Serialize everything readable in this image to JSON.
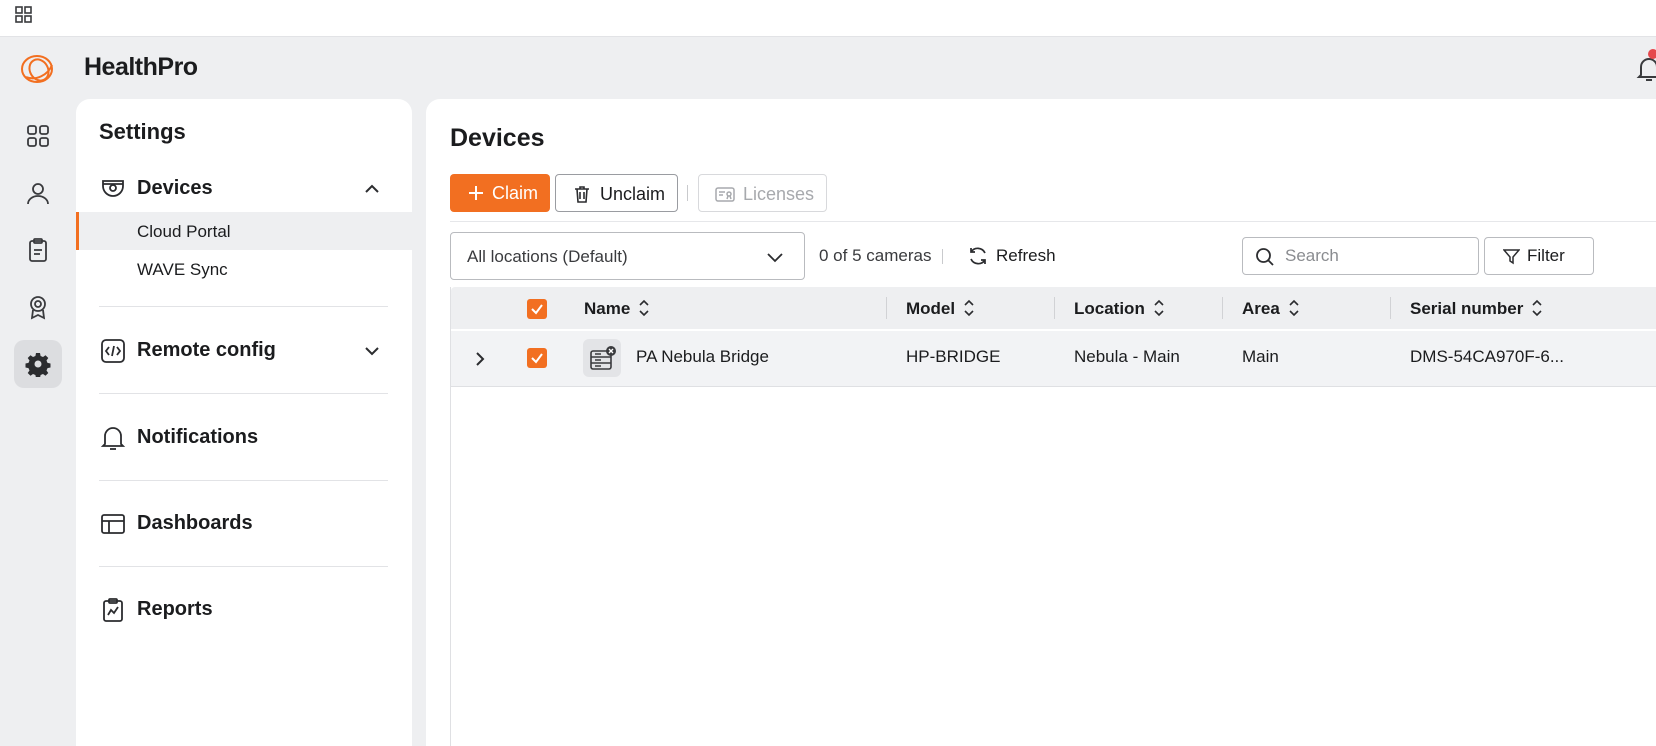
{
  "app": {
    "name": "HealthPro"
  },
  "settings": {
    "title": "Settings",
    "sections": {
      "devices": "Devices",
      "cloud_portal": "Cloud Portal",
      "wave_sync": "WAVE Sync",
      "remote_config": "Remote config",
      "notifications": "Notifications",
      "dashboards": "Dashboards",
      "reports": "Reports"
    }
  },
  "page": {
    "title": "Devices",
    "actions": {
      "claim": "Claim",
      "unclaim": "Unclaim",
      "licenses": "Licenses"
    },
    "location_select": "All locations (Default)",
    "count": "0 of 5 cameras",
    "refresh": "Refresh",
    "search_placeholder": "Search",
    "filter": "Filter"
  },
  "table": {
    "headers": {
      "name": "Name",
      "model": "Model",
      "location": "Location",
      "area": "Area",
      "serial": "Serial number"
    },
    "rows": [
      {
        "name": "PA Nebula Bridge",
        "model": "HP-BRIDGE",
        "location": "Nebula - Main",
        "area": "Main",
        "serial": "DMS-54CA970F-6...",
        "checked": true
      }
    ]
  },
  "colors": {
    "accent": "#f26f21",
    "notification_dot": "#e5484d"
  }
}
